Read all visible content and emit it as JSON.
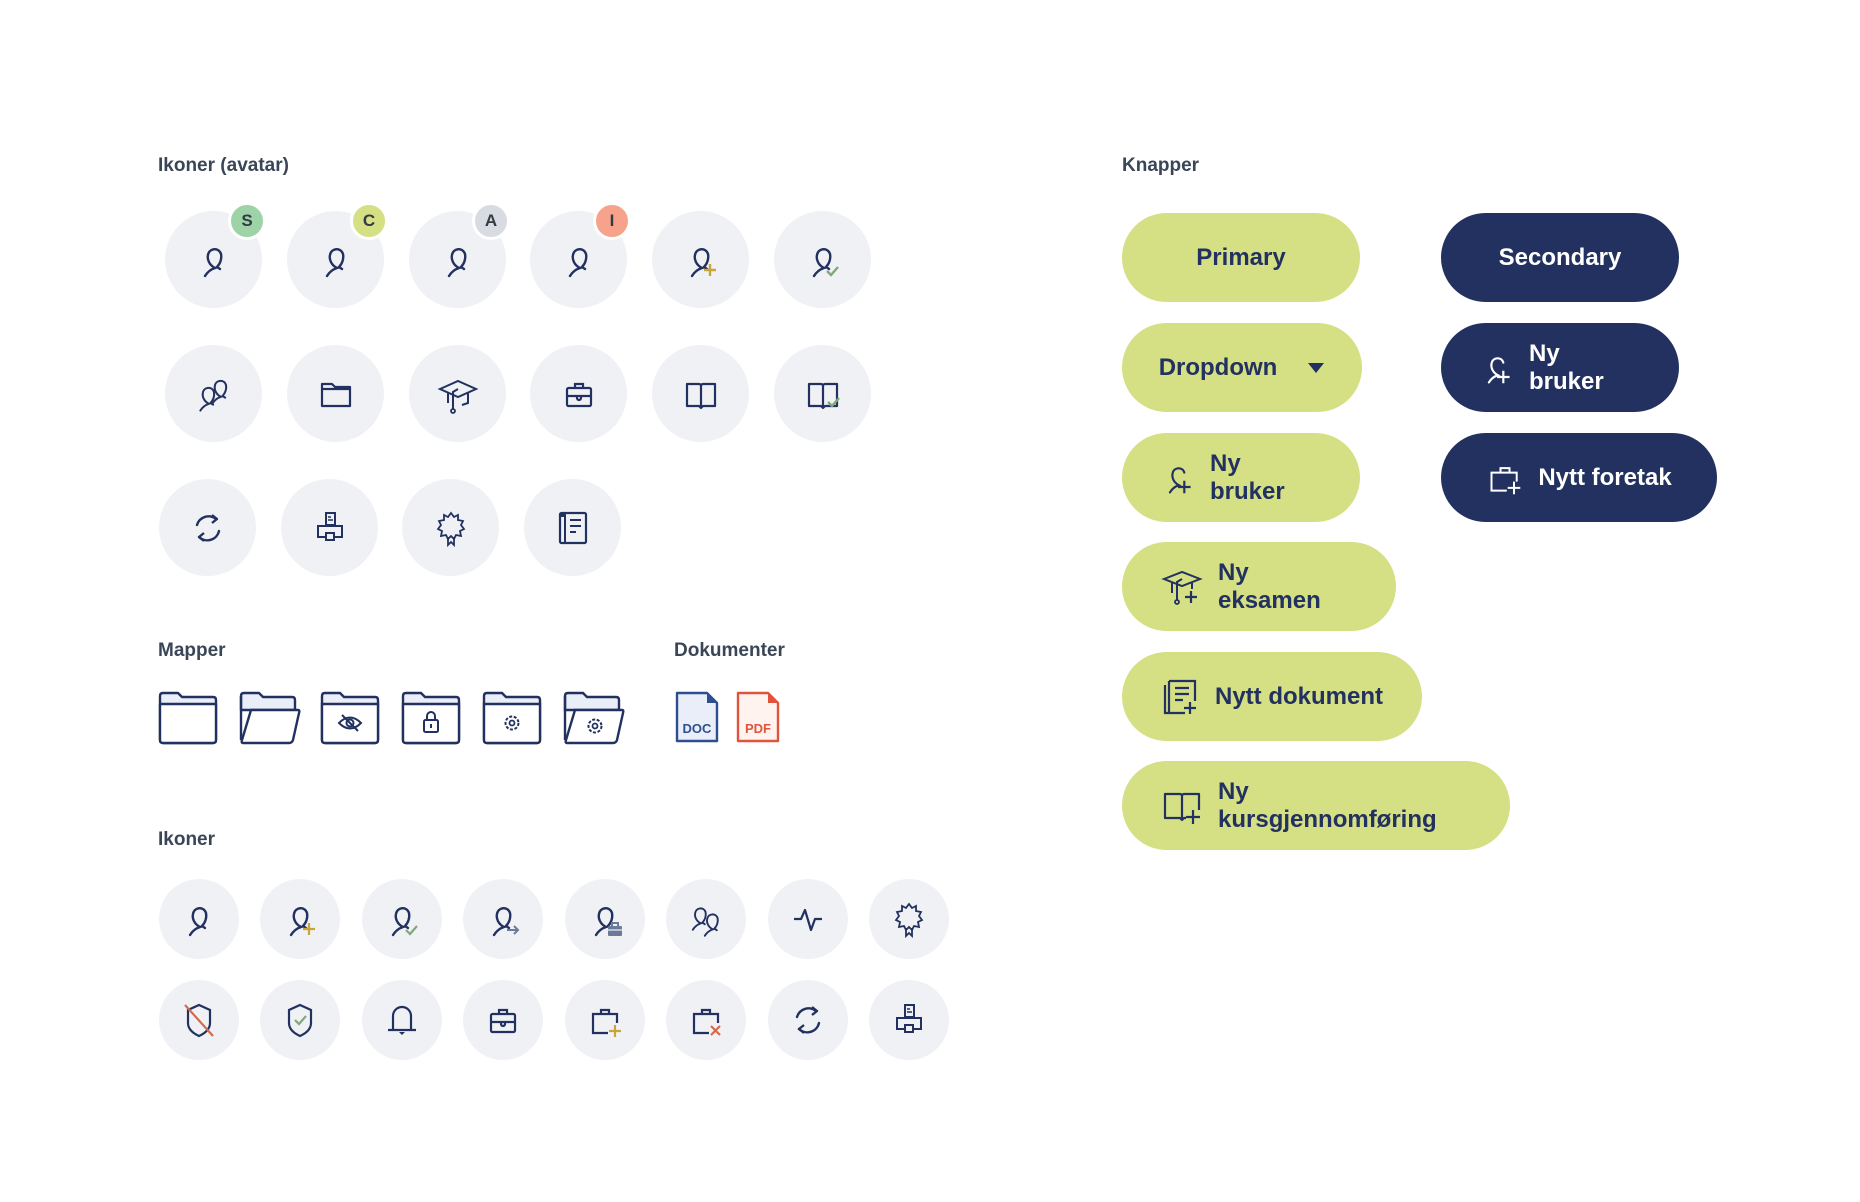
{
  "sections": {
    "avatar_icons": "Ikoner (avatar)",
    "folders": "Mapper",
    "documents": "Dokumenter",
    "icons": "Ikoner",
    "buttons": "Knapper"
  },
  "colors": {
    "navy": "#22315f",
    "lime": "#d5df84",
    "circle_bg": "#f0f1f5",
    "label": "#3a4657",
    "gold": "#c9a43a",
    "green_check": "#7fa876",
    "orange_x": "#d46a4c",
    "pdf_red": "#e2533b",
    "doc_blue": "#2e4f8f"
  },
  "avatar_icons": {
    "row1": [
      {
        "icon": "user-icon",
        "badge": "S",
        "badge_color": "#9ed3a8"
      },
      {
        "icon": "user-icon",
        "badge": "C",
        "badge_color": "#d5df84"
      },
      {
        "icon": "user-icon",
        "badge": "A",
        "badge_color": "#d9dbe3"
      },
      {
        "icon": "user-icon",
        "badge": "I",
        "badge_color": "#f7a28b"
      },
      {
        "icon": "user-add-icon"
      },
      {
        "icon": "user-check-icon"
      }
    ],
    "row2": [
      "users-icon",
      "folder-icon",
      "graduation-cap-icon",
      "briefcase-icon",
      "book-icon",
      "book-check-icon"
    ],
    "row3": [
      "refresh-icon",
      "org-chart-icon",
      "certificate-icon",
      "document-list-icon"
    ]
  },
  "folders": [
    "folder-icon",
    "folder-open-icon",
    "folder-hidden-icon",
    "folder-locked-icon",
    "folder-settings-icon",
    "folder-open-settings-icon"
  ],
  "documents": [
    {
      "icon": "doc-file-icon",
      "label": "DOC"
    },
    {
      "icon": "pdf-file-icon",
      "label": "PDF"
    }
  ],
  "icons": {
    "row1": [
      "user-icon",
      "user-add-icon",
      "user-check-icon",
      "user-arrow-icon",
      "user-briefcase-icon",
      "users-icon",
      "activity-icon",
      "certificate-icon"
    ],
    "row2": [
      "shield-off-icon",
      "shield-check-icon",
      "bell-icon",
      "briefcase-icon",
      "briefcase-add-icon",
      "briefcase-remove-icon",
      "refresh-icon",
      "org-chart-icon"
    ]
  },
  "buttons": {
    "primary": "Primary",
    "secondary": "Secondary",
    "dropdown": "Dropdown",
    "new_user_primary": "Ny bruker",
    "new_user_secondary": "Ny bruker",
    "new_company": "Nytt foretak",
    "new_exam": "Ny eksamen",
    "new_document": "Nytt dokument",
    "new_course": "Ny kursgjennomføring"
  }
}
